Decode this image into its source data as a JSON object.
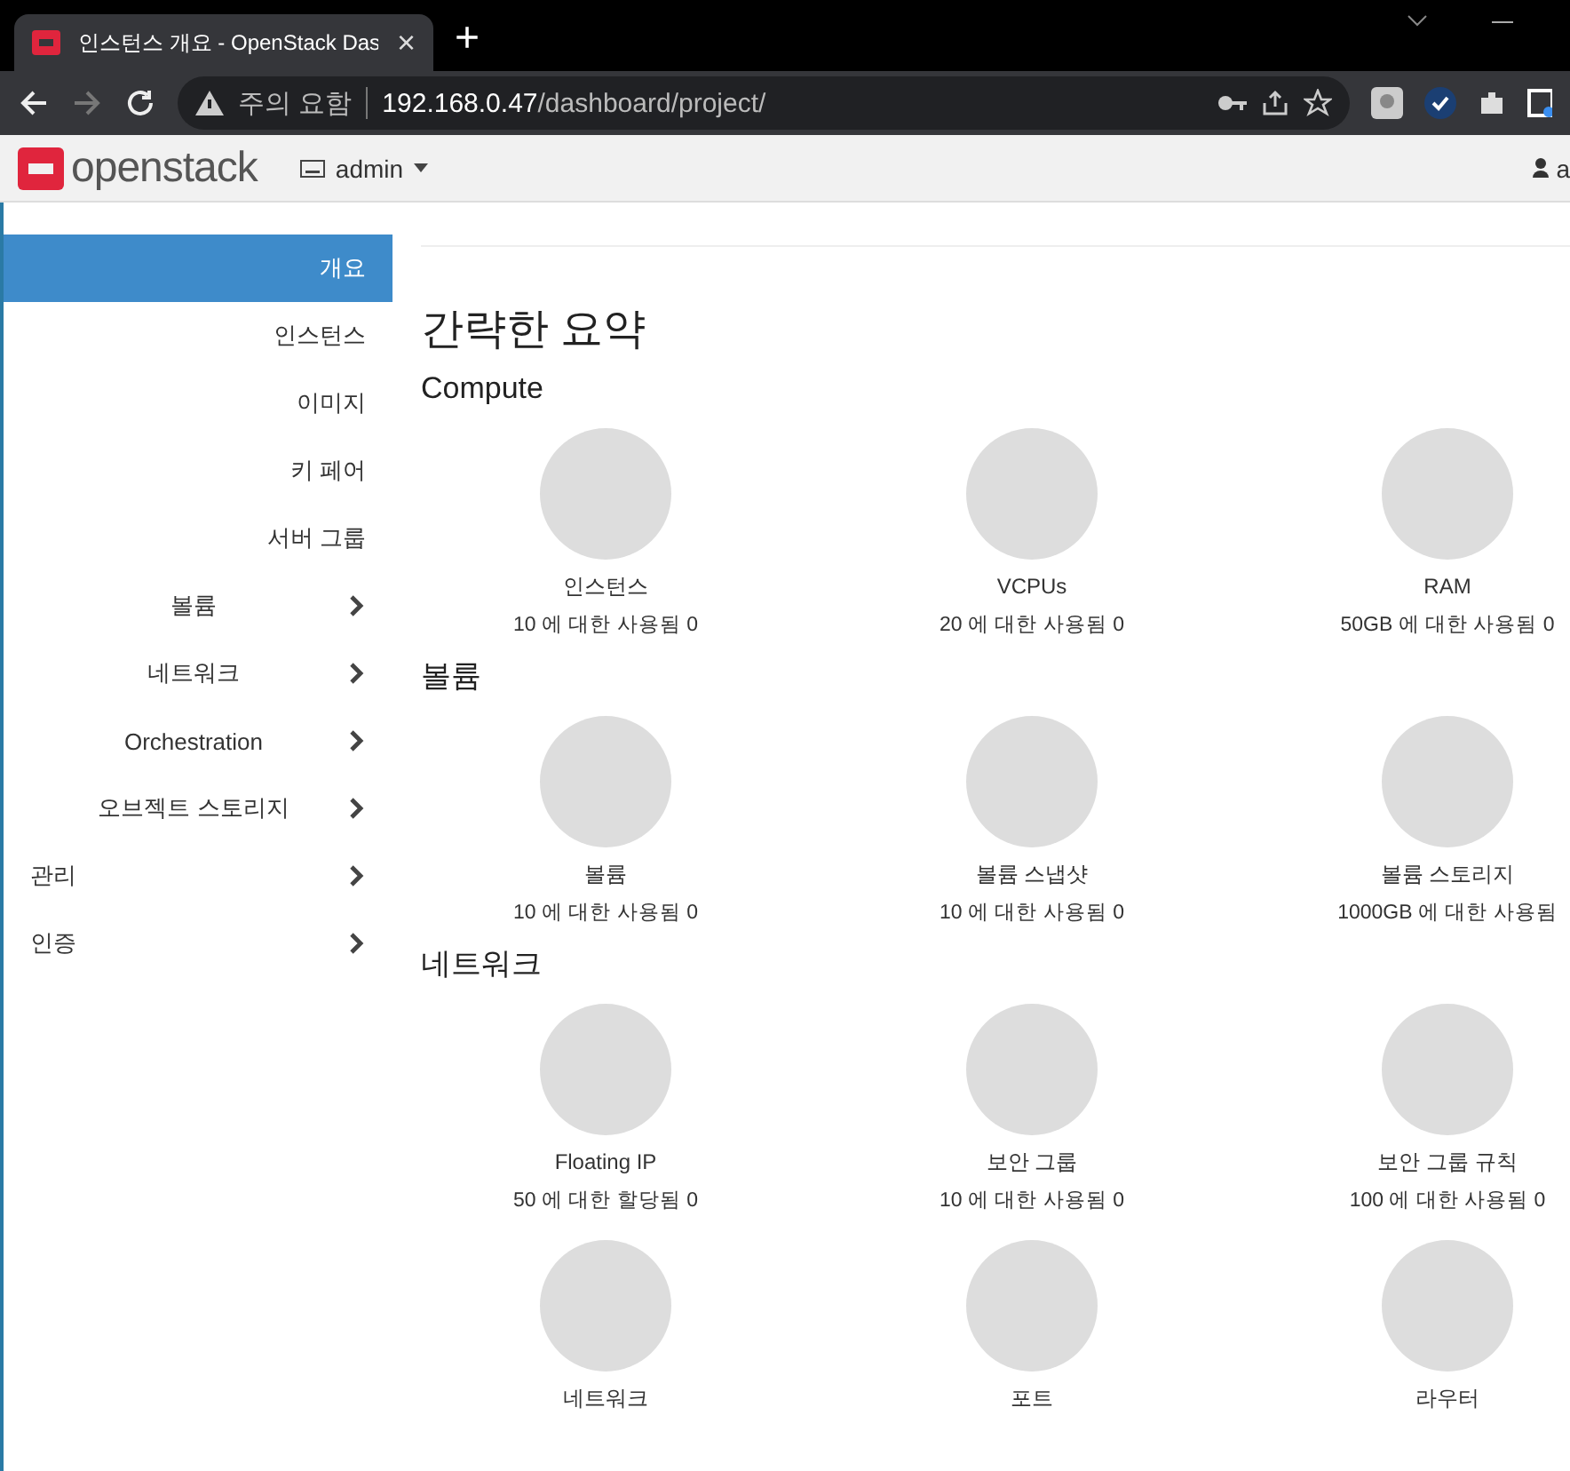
{
  "browser": {
    "tab_title": "인스턴스 개요 - OpenStack Das",
    "close": "×",
    "new_tab": "+",
    "security": "주의 요함",
    "url_host": "192.168.0.47",
    "url_path": "/dashboard/project/"
  },
  "header": {
    "brand": "openstack",
    "project": "admin",
    "user": "a"
  },
  "sidebar": {
    "items": [
      {
        "label": "개요",
        "kind": "sub",
        "selected": true
      },
      {
        "label": "인스턴스",
        "kind": "sub",
        "selected": false
      },
      {
        "label": "이미지",
        "kind": "sub",
        "selected": false
      },
      {
        "label": "키 페어",
        "kind": "sub",
        "selected": false
      },
      {
        "label": "서버 그룹",
        "kind": "sub",
        "selected": false
      },
      {
        "label": "볼륨",
        "kind": "group",
        "selected": false
      },
      {
        "label": "네트워크",
        "kind": "group",
        "selected": false
      },
      {
        "label": "Orchestration",
        "kind": "group",
        "selected": false
      },
      {
        "label": "오브젝트 스토리지",
        "kind": "group",
        "selected": false
      },
      {
        "label": "관리",
        "kind": "top",
        "selected": false
      },
      {
        "label": "인증",
        "kind": "top",
        "selected": false
      }
    ]
  },
  "content": {
    "title": "간략한 요약",
    "sections": [
      {
        "title": "Compute",
        "items": [
          {
            "label": "인스턴스",
            "reading": "10 에 대한 사용됨 0"
          },
          {
            "label": "VCPUs",
            "reading": "20 에 대한 사용됨 0"
          },
          {
            "label": "RAM",
            "reading": "50GB 에 대한 사용됨 0"
          }
        ]
      },
      {
        "title": "볼륨",
        "items": [
          {
            "label": "볼륨",
            "reading": "10 에 대한 사용됨 0"
          },
          {
            "label": "볼륨 스냅샷",
            "reading": "10 에 대한 사용됨 0"
          },
          {
            "label": "볼륨 스토리지",
            "reading": "1000GB 에 대한 사용됨"
          }
        ]
      },
      {
        "title": "네트워크",
        "items": [
          {
            "label": "Floating IP",
            "reading": "50 에 대한 할당됨 0"
          },
          {
            "label": "보안 그룹",
            "reading": "10 에 대한 사용됨 0"
          },
          {
            "label": "보안 그룹 규칙",
            "reading": "100 에 대한 사용됨 0"
          },
          {
            "label": "네트워크"
          },
          {
            "label": "포트"
          },
          {
            "label": "라우터"
          }
        ]
      }
    ]
  }
}
